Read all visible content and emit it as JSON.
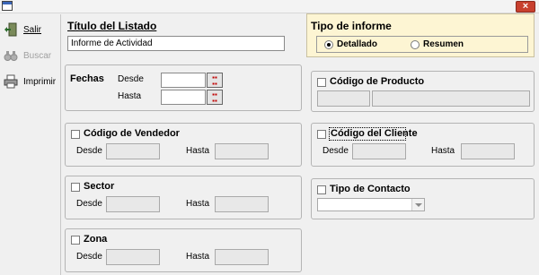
{
  "window": {
    "close_label": "×"
  },
  "toolbar": {
    "salir": "Salir",
    "buscar": "Buscar",
    "imprimir": "Imprimir"
  },
  "titulo": {
    "label": "Título del Listado",
    "value": "Informe de Actividad"
  },
  "fechas": {
    "label": "Fechas",
    "desde": "Desde",
    "hasta": "Hasta",
    "desde_value": "",
    "hasta_value": ""
  },
  "vendedor": {
    "label": "Código de Vendedor",
    "desde": "Desde",
    "hasta": "Hasta",
    "checked": false
  },
  "sector": {
    "label": "Sector",
    "desde": "Desde",
    "hasta": "Hasta",
    "checked": false
  },
  "zona": {
    "label": "Zona",
    "desde": "Desde",
    "hasta": "Hasta",
    "checked": false
  },
  "tipo_informe": {
    "label": "Tipo de informe",
    "options": [
      "Detallado",
      "Resumen"
    ],
    "selected": "Detallado"
  },
  "producto": {
    "label": "Código de Producto",
    "checked": false
  },
  "cliente": {
    "label": "Código del Cliente",
    "desde": "Desde",
    "hasta": "Hasta",
    "checked": false
  },
  "contacto": {
    "label": "Tipo de Contacto",
    "checked": false,
    "selected_value": ""
  },
  "colors": {
    "tipo_background": "#fdf5d3",
    "close_button": "#c8402e",
    "calendar_icon": "#c00000"
  }
}
